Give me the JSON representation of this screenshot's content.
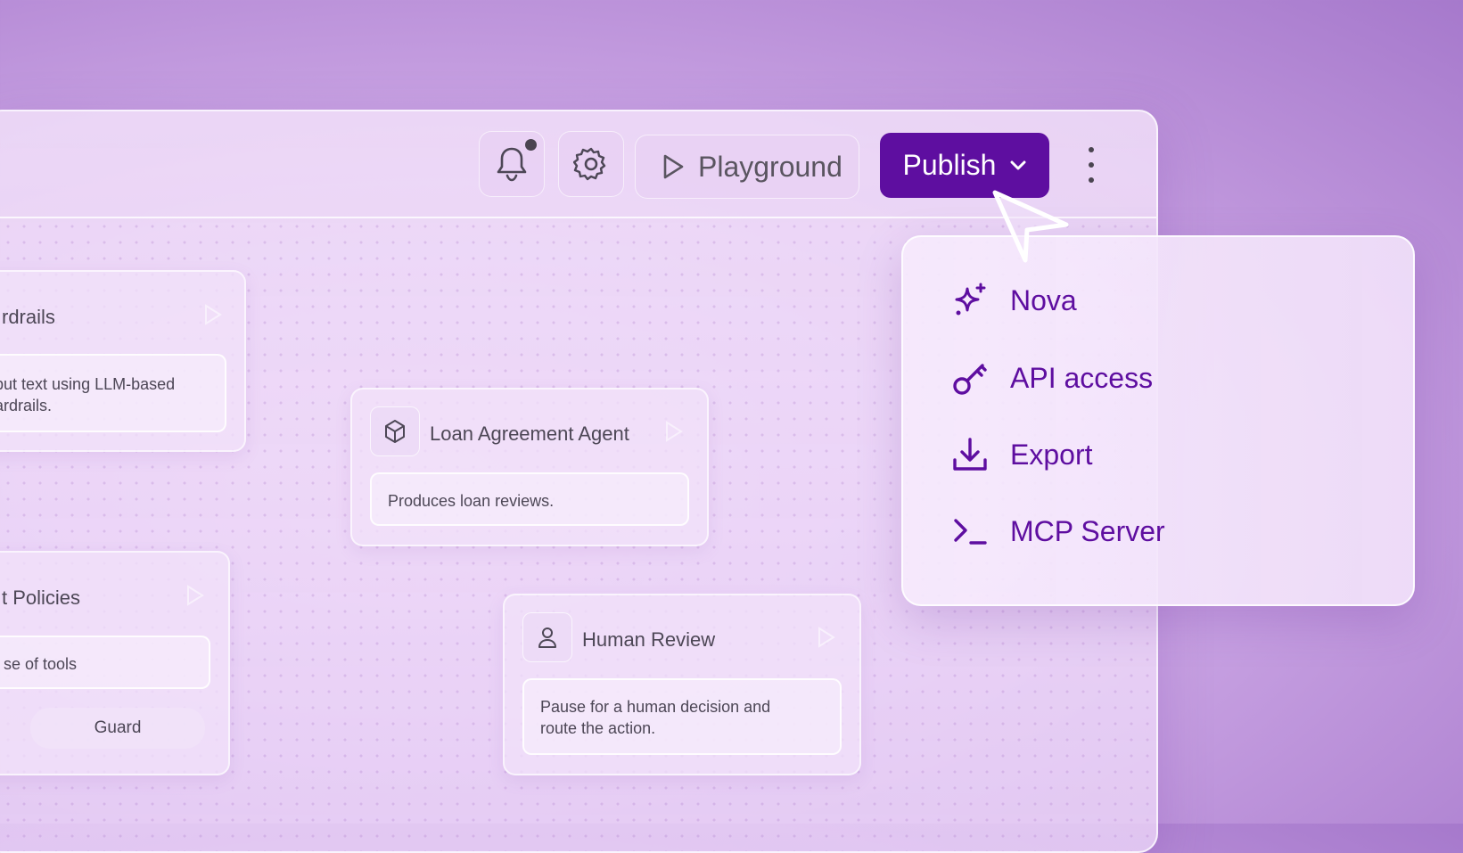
{
  "toolbar": {
    "playground_label": "Playground",
    "publish_label": "Publish",
    "icons": {
      "notifications": "bell-icon",
      "settings": "gear-icon",
      "play": "play-icon",
      "publish_menu": "chevron-down-icon",
      "more": "kebab-icon"
    },
    "notification_badge": true
  },
  "colors": {
    "accent": "#5e0ea0",
    "background_start": "#e6c8f2",
    "background_end": "#a679cc"
  },
  "nodes": {
    "guardrails": {
      "title": "rdrails",
      "description_line1": "nput text using LLM-based",
      "description_line2": "uardrails."
    },
    "loan_agent": {
      "title": "Loan Agreement Agent",
      "icon": "cube-icon",
      "description": "Produces loan reviews."
    },
    "policies": {
      "title": "t Policies",
      "description": "se of tools",
      "action_label": "Guard"
    },
    "human_review": {
      "title": "Human Review",
      "icon": "person-icon",
      "description_line1": "Pause for a human decision and",
      "description_line2": "route the action."
    }
  },
  "publish_menu": {
    "items": [
      {
        "label": "Nova",
        "icon": "sparkles-icon"
      },
      {
        "label": "API access",
        "icon": "key-icon"
      },
      {
        "label": "Export",
        "icon": "download-icon"
      },
      {
        "label": "MCP Server",
        "icon": "terminal-icon"
      }
    ]
  }
}
